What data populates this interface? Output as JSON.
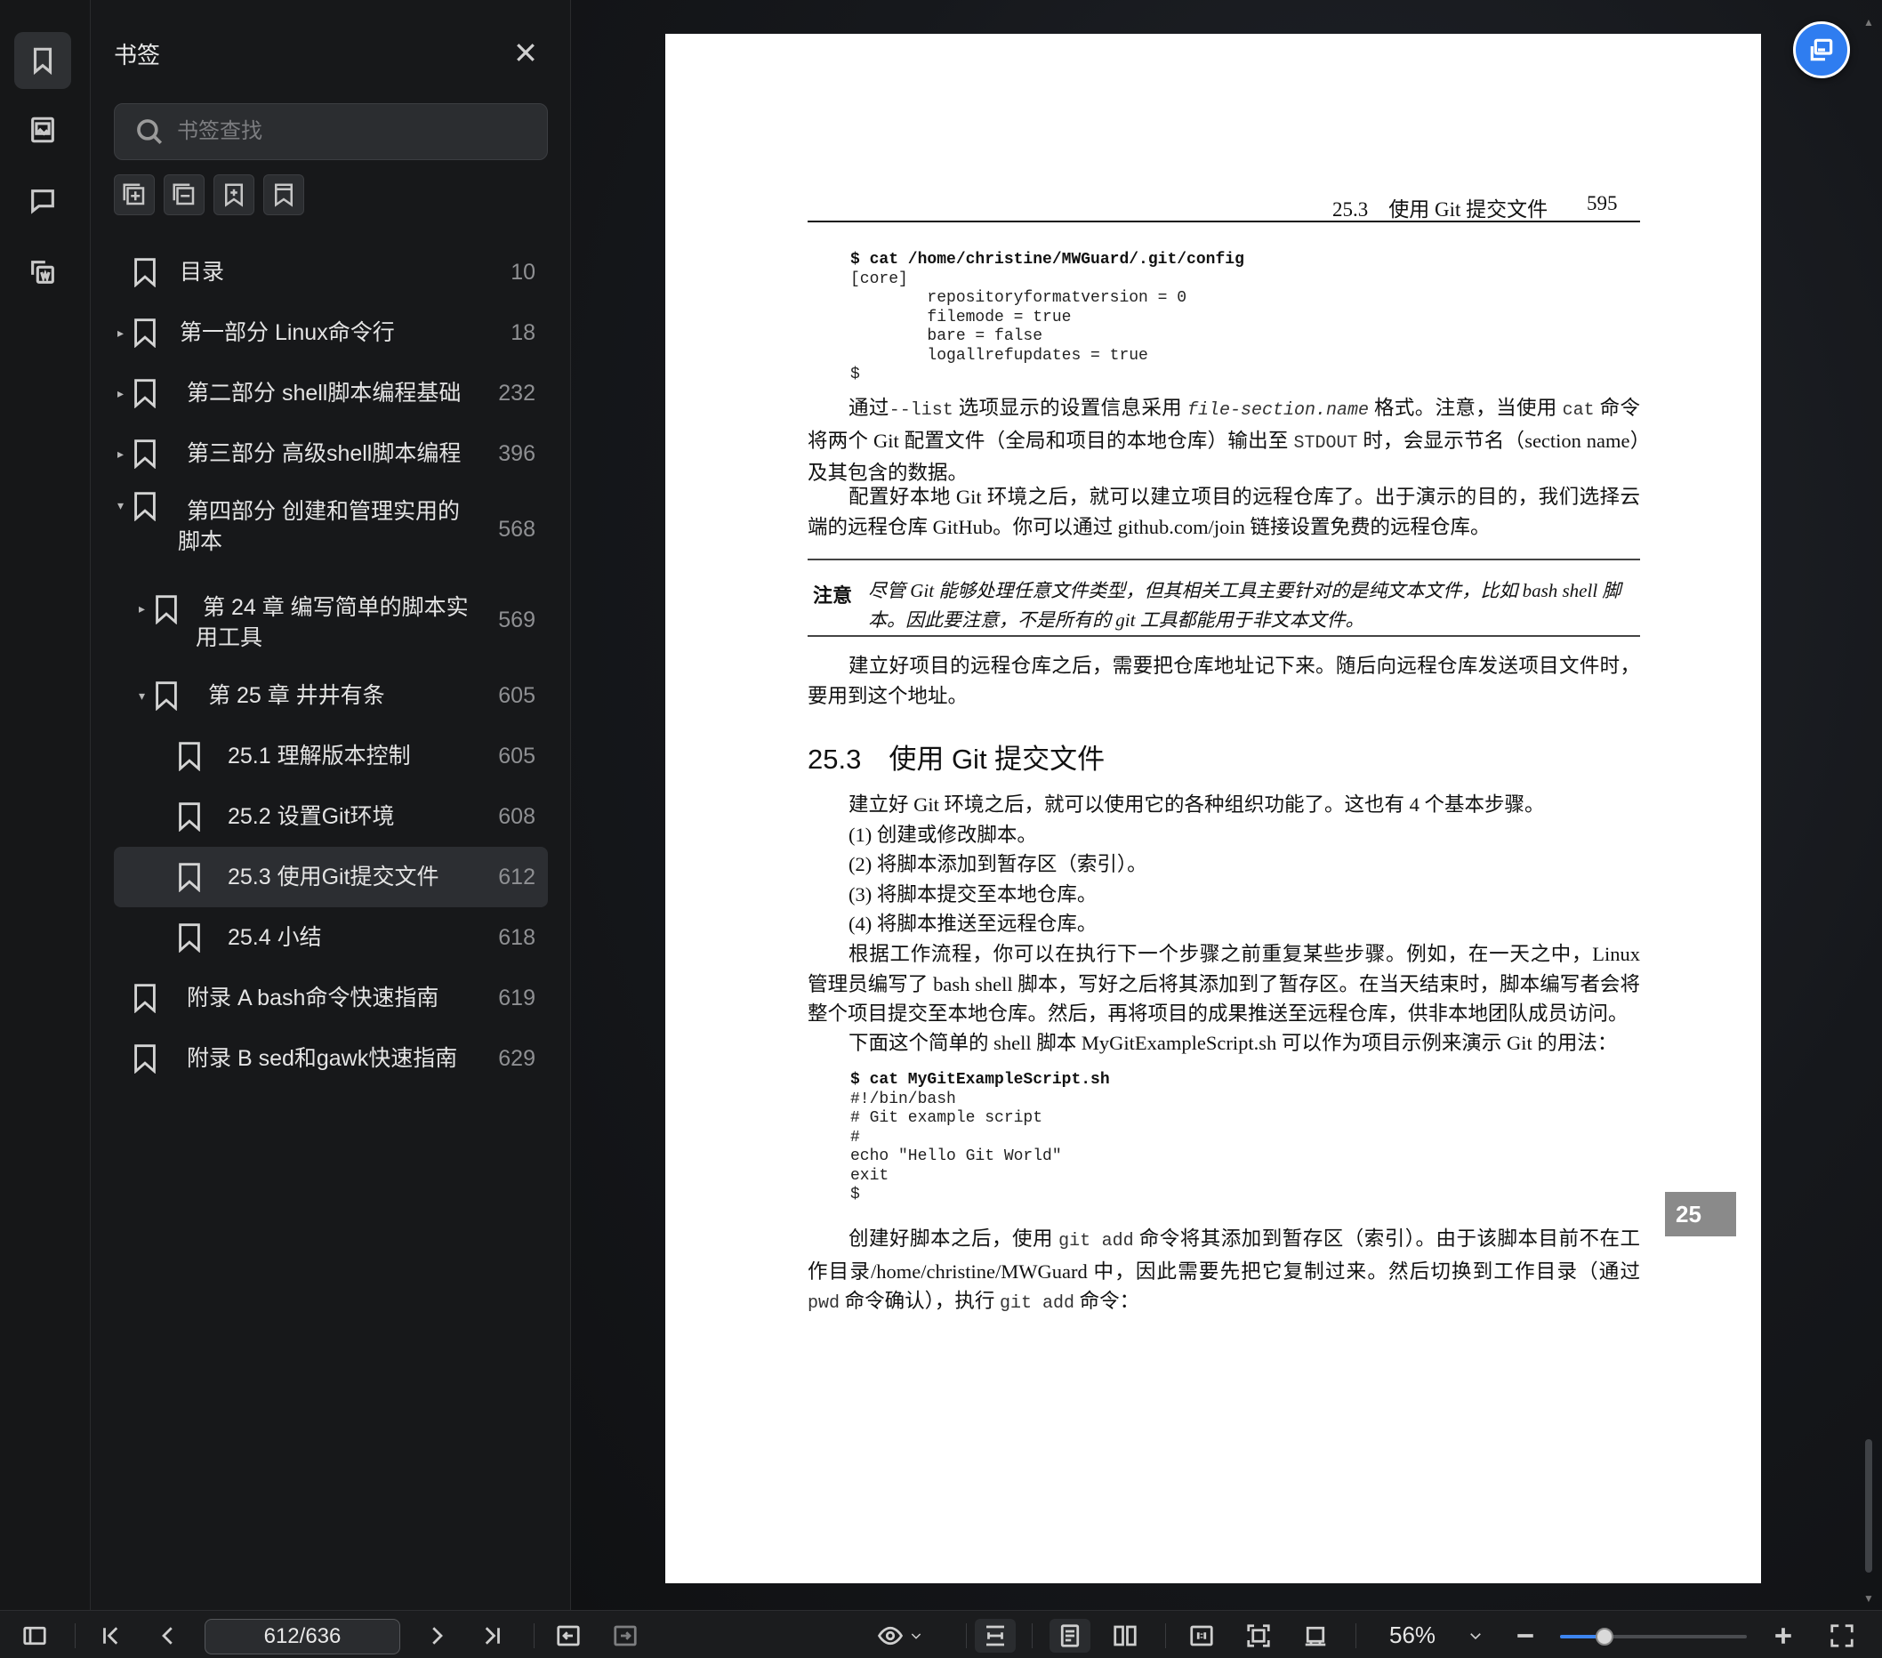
{
  "sidebar": {
    "title": "书签",
    "search_placeholder": "书签查找",
    "items": [
      {
        "label": "目录",
        "page": "10"
      },
      {
        "label": "第一部分 Linux命令行",
        "page": "18"
      },
      {
        "label": "第二部分 shell脚本编程基础",
        "page": "232"
      },
      {
        "label": "第三部分 高级shell脚本编程",
        "page": "396"
      },
      {
        "label": "第四部分 创建和管理实用的脚本",
        "page": "568"
      },
      {
        "label": "第 24 章 编写简单的脚本实用工具",
        "page": "569"
      },
      {
        "label": "第 25 章 井井有条",
        "page": "605"
      },
      {
        "label": "25.1 理解版本控制",
        "page": "605"
      },
      {
        "label": "25.2 设置Git环境",
        "page": "608"
      },
      {
        "label": "25.3 使用Git提交文件",
        "page": "612"
      },
      {
        "label": "25.4 小结",
        "page": "618"
      },
      {
        "label": "附录 A bash命令快速指南",
        "page": "619"
      },
      {
        "label": "附录 B sed和gawk快速指南",
        "page": "629"
      }
    ]
  },
  "document": {
    "header_section": "25.3　使用 Git 提交文件",
    "header_page": "595",
    "code1": {
      "cmd": "$ cat /home/christine/MWGuard/.git/config",
      "lines": [
        "[core]",
        "        repositoryformatversion = 0",
        "        filemode = true",
        "        bare = false",
        "        logallrefupdates = true",
        "$"
      ]
    },
    "p1_a": "通过",
    "p1_b": "--list",
    "p1_c": " 选项显示的设置信息采用 ",
    "p1_d": "file-section.name",
    "p1_e": " 格式。注意，当使用 ",
    "p1_f": "cat",
    "p1_g": " 命令将两个 Git 配置文件（全局和项目的本地仓库）输出至 ",
    "p1_h": "STDOUT",
    "p1_i": " 时，会显示节名（section name）及其包含的数据。",
    "p2": "配置好本地 Git 环境之后，就可以建立项目的远程仓库了。出于演示的目的，我们选择云端的远程仓库 GitHub。你可以通过 github.com/join 链接设置免费的远程仓库。",
    "note_label": "注意",
    "note_text": "尽管 Git 能够处理任意文件类型，但其相关工具主要针对的是纯文本文件，比如 bash shell 脚本。因此要注意，不是所有的 git 工具都能用于非文本文件。",
    "p3": "建立好项目的远程仓库之后，需要把仓库地址记下来。随后向远程仓库发送项目文件时，要用到这个地址。",
    "section_title": "25.3　使用 Git 提交文件",
    "p4": "建立好 Git 环境之后，就可以使用它的各种组织功能了。这也有 4 个基本步骤。",
    "steps": [
      "(1) 创建或修改脚本。",
      "(2) 将脚本添加到暂存区（索引）。",
      "(3) 将脚本提交至本地仓库。",
      "(4) 将脚本推送至远程仓库。"
    ],
    "p5": "根据工作流程，你可以在执行下一个步骤之前重复某些步骤。例如，在一天之中，Linux 管理员编写了 bash shell 脚本，写好之后将其添加到了暂存区。在当天结束时，脚本编写者会将整个项目提交至本地仓库。然后，再将项目的成果推送至远程仓库，供非本地团队成员访问。",
    "p6": "下面这个简单的 shell 脚本 MyGitExampleScript.sh 可以作为项目示例来演示 Git 的用法：",
    "code2": {
      "cmd": "$ cat MyGitExampleScript.sh",
      "lines": [
        "#!/bin/bash",
        "# Git example script",
        "#",
        "echo \"Hello Git World\"",
        "exit",
        "$"
      ]
    },
    "p7_a": "创建好脚本之后，使用 ",
    "p7_b": "git add",
    "p7_c": " 命令将其添加到暂存区（索引）。由于该脚本目前不在工作目录/home/christine/MWGuard 中，因此需要先把它复制过来。然后切换到工作目录（通过 ",
    "p7_d": "pwd",
    "p7_e": " 命令确认），执行 ",
    "p7_f": "git add",
    "p7_g": " 命令：",
    "chapter_tab": "25"
  },
  "toolbar": {
    "page_indicator": "612/636",
    "zoom": "56%",
    "zoom_fraction": 0.24
  }
}
